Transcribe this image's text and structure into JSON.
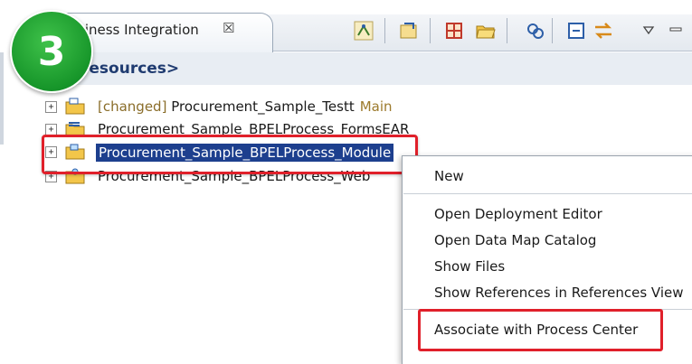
{
  "step_badge": "3",
  "tab": {
    "label": "siness Integration",
    "close_symbol": "☒"
  },
  "toolbar": {
    "icons": [
      "hierarchy-icon",
      "import-icon",
      "grid-icon",
      "open-folder-icon",
      "link-icon",
      "collapse-icon",
      "sync-arrows-icon",
      "view-menu-icon",
      "minimize-icon"
    ]
  },
  "resources_label": "resources>",
  "tree": {
    "items": [
      {
        "changed_prefix": "[changed]",
        "label": "Procurement_Sample_Testt",
        "tag": "Main"
      },
      {
        "label": "Procurement_Sample_BPELProcess_FormsEAR"
      },
      {
        "label": "Procurement_Sample_BPELProcess_Module"
      },
      {
        "label": "Procurement_Sample_BPELProcess_Web"
      }
    ]
  },
  "context_menu": {
    "items": [
      "New",
      "Open Deployment Editor",
      "Open Data Map Catalog",
      "Show Files",
      "Show References in References View",
      "Associate with Process Center"
    ]
  },
  "colors": {
    "highlight_red": "#e0202a",
    "selection_blue": "#1d3f8e",
    "badge_green": "#17962a"
  }
}
